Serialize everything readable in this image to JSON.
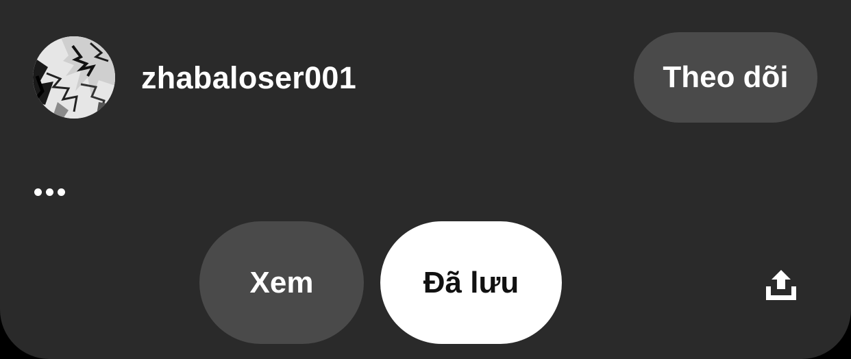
{
  "profile": {
    "username": "zhabaloser001",
    "avatar_icon": "manga-character-avatar"
  },
  "actions": {
    "follow_label": "Theo dõi",
    "more_icon": "more-horizontal-icon",
    "view_label": "Xem",
    "saved_label": "Đã lưu",
    "share_icon": "share-upload-icon"
  },
  "colors": {
    "background": "#2a2a2a",
    "button_gray": "#4a4a4a",
    "button_white": "#ffffff",
    "text_light": "#ffffff",
    "text_dark": "#111111"
  }
}
